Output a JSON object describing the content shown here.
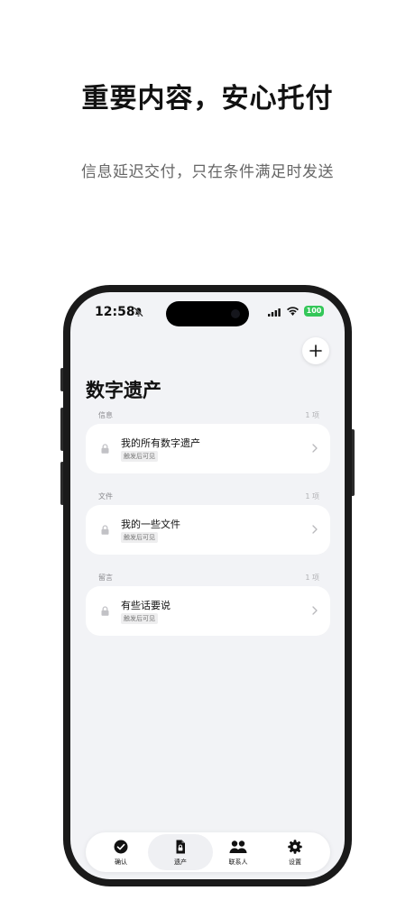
{
  "hero": {
    "title": "重要内容，安心托付",
    "subtitle": "信息延迟交付，只在条件满足时发送"
  },
  "status_bar": {
    "time": "12:58",
    "battery": "100",
    "battery_color": "#34c759"
  },
  "page": {
    "title": "数字遗产"
  },
  "sections": [
    {
      "label": "信息",
      "count": "1 项",
      "item": {
        "title": "我的所有数字遗产",
        "tag": "触发后可见"
      }
    },
    {
      "label": "文件",
      "count": "1 项",
      "item": {
        "title": "我的一些文件",
        "tag": "触发后可见"
      }
    },
    {
      "label": "留言",
      "count": "1 项",
      "item": {
        "title": "有些话要说",
        "tag": "触发后可见"
      }
    }
  ],
  "tabs": [
    {
      "label": "确认",
      "icon": "check-circle-icon",
      "active": false
    },
    {
      "label": "遗产",
      "icon": "document-icon",
      "active": true
    },
    {
      "label": "联系人",
      "icon": "people-icon",
      "active": false
    },
    {
      "label": "设置",
      "icon": "gear-icon",
      "active": false
    }
  ]
}
